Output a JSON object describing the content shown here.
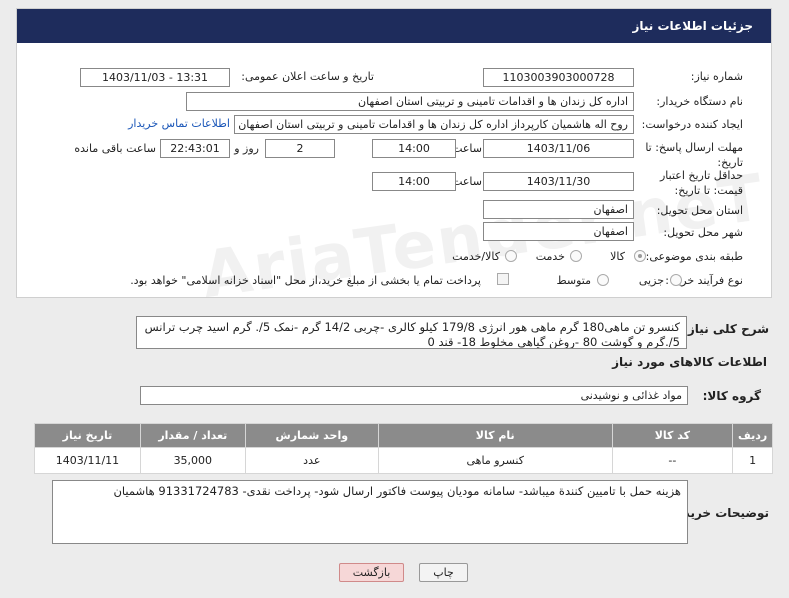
{
  "header": {
    "title": "جزئیات اطلاعات نیاز"
  },
  "form": {
    "need_number_label": "شماره نیاز:",
    "need_number": "1103003903000728",
    "announce_label": "تاریخ و ساعت اعلان عمومی:",
    "announce_value": "1403/11/03 - 13:31",
    "buyer_org_label": "نام دستگاه خریدار:",
    "buyer_org": "اداره کل زندان ها و اقدامات تامینی و تربیتی استان اصفهان",
    "creator_label": "ایجاد کننده درخواست:",
    "creator": "روح اله هاشمیان کارپرداز اداره کل زندان ها و اقدامات تامینی و تربیتی استان اصفهان",
    "contact_link": "اطلاعات تماس خریدار",
    "deadline_label": "مهلت ارسال پاسخ: تا تاریخ:",
    "deadline_date": "1403/11/06",
    "time_label": "ساعت",
    "deadline_time": "14:00",
    "days_value": "2",
    "days_label": "روز و",
    "remaining_time": "22:43:01",
    "remaining_label": "ساعت باقی مانده",
    "validity_label": "حداقل تاریخ اعتبار قیمت: تا تاریخ:",
    "validity_date": "1403/11/30",
    "validity_time": "14:00",
    "province_label": "استان محل تحویل:",
    "province": "اصفهان",
    "city_label": "شهر محل تحویل:",
    "city": "اصفهان",
    "category_label": "طبقه بندی موضوعی:",
    "category_options": [
      "کالا",
      "خدمت",
      "کالا/خدمت"
    ],
    "purchase_type_label": "نوع فرآیند خرید :",
    "purchase_options": [
      "جزیی",
      "متوسط"
    ],
    "payment_note": "پرداخت تمام یا بخشی از مبلغ خرید،از محل \"اسناد خزانه اسلامی\" خواهد بود."
  },
  "details": {
    "general_desc_label": "شرح کلی نیاز:",
    "general_desc": "کنسرو تن ماهی180 گرم ماهی هور انرژی 179/8 کیلو کالری -چربی 14/2 گرم  -نمک 5/. گرم اسید چرب ترانس 5/.گرم و گوشت 80 -روغن گیاهی مخلوط 18- قند 0",
    "goods_info_title": "اطلاعات کالاهای مورد نیاز",
    "goods_group_label": "گروه کالا:",
    "goods_group": "مواد غذائی و نوشیدنی"
  },
  "table": {
    "headers": [
      "ردیف",
      "کد کالا",
      "نام کالا",
      "واحد شمارش",
      "تعداد / مقدار",
      "تاریخ نیاز"
    ],
    "rows": [
      [
        "1",
        "--",
        "کنسرو ماهی",
        "عدد",
        "35,000",
        "1403/11/11"
      ]
    ]
  },
  "buyer_notes": {
    "label": "توضیحات خریدار:",
    "text": "هزینه حمل با تامیین کنندة میباشد- سامانه مودیان پیوست فاکتور ارسال شود- پرداخت نقدی- 91331724783 هاشمیان"
  },
  "buttons": {
    "print": "چاپ",
    "back": "بازگشت"
  },
  "watermark": "AriaTender.neT"
}
